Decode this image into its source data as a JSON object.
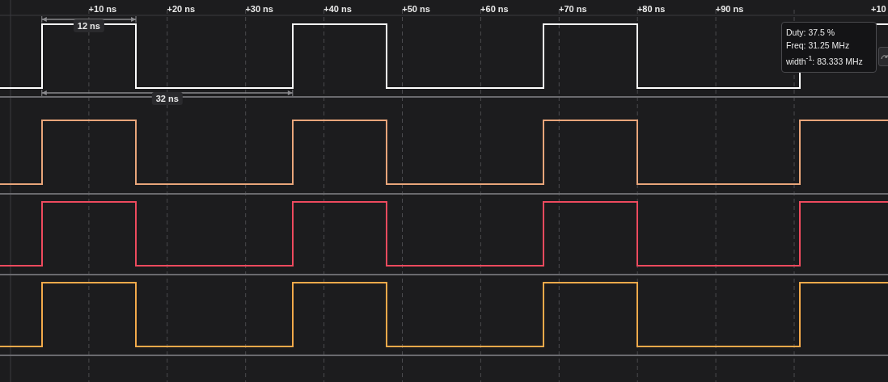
{
  "time_axis": {
    "ticks": [
      "+10 ns",
      "+20 ns",
      "+30 ns",
      "+40 ns",
      "+50 ns",
      "+60 ns",
      "+70 ns",
      "+80 ns",
      "+90 ns",
      "+10"
    ]
  },
  "measurements": [
    {
      "label": "12 ns"
    },
    {
      "label": "32 ns"
    }
  ],
  "channels": [
    {
      "color": "#ffffff"
    },
    {
      "color": "#e8a57a"
    },
    {
      "color": "#ee4a5e"
    },
    {
      "color": "#f2a94a"
    }
  ],
  "tooltip": {
    "lines": [
      "Duty: 37.5 %",
      "Freq: 31.25 MHz",
      "width$^{-1}$: 83.333 MHz"
    ]
  }
}
